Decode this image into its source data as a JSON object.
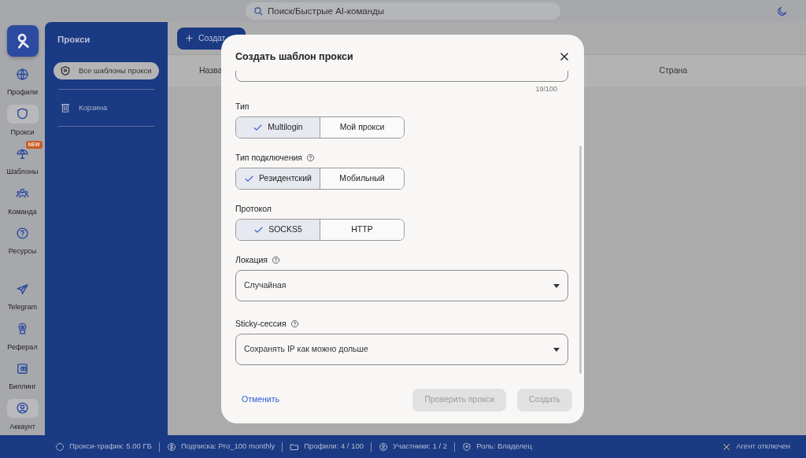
{
  "topbar": {
    "search": {
      "placeholder": "Поиск/Быстрые AI-команды"
    }
  },
  "rail": {
    "items": [
      {
        "label": "Профили",
        "selected": false
      },
      {
        "label": "Прокси",
        "selected": true
      },
      {
        "label": "Шаблоны",
        "selected": false,
        "badge": "NEW"
      },
      {
        "label": "Команда",
        "selected": false
      },
      {
        "label": "Ресурсы",
        "selected": false
      }
    ],
    "bottom_items": [
      {
        "label": "Telegram",
        "selected": false
      },
      {
        "label": "Реферал",
        "selected": false
      },
      {
        "label": "Биллинг",
        "selected": false
      },
      {
        "label": "Аккаунт",
        "selected": true
      }
    ]
  },
  "panel": {
    "title": "Прокси",
    "items": [
      {
        "label": "Все шаблоны прокси",
        "selected": true
      },
      {
        "label": "Корзина",
        "selected": false
      }
    ]
  },
  "toolbar": {
    "create_button": "Создат"
  },
  "table": {
    "columns": [
      "Назва",
      "Страна"
    ]
  },
  "modal": {
    "title": "Создать шаблон прокси",
    "name_counter": "19/100",
    "fields": [
      {
        "kind": "segmented",
        "label": "Тип",
        "help": false,
        "options": [
          {
            "label": "Multilogin",
            "selected": true
          },
          {
            "label": "Мой прокси",
            "selected": false
          }
        ]
      },
      {
        "kind": "segmented",
        "label": "Тип подключения",
        "help": true,
        "options": [
          {
            "label": "Резидентский",
            "selected": true
          },
          {
            "label": "Мобильный",
            "selected": false
          }
        ]
      },
      {
        "kind": "segmented",
        "label": "Протокол",
        "help": false,
        "options": [
          {
            "label": "SOCKS5",
            "selected": true
          },
          {
            "label": "HTTP",
            "selected": false
          }
        ]
      },
      {
        "kind": "select",
        "label": "Локация",
        "help": true,
        "value": "Случайная"
      },
      {
        "kind": "select",
        "label": "Sticky-сессия",
        "help": true,
        "value": "Сохранять IP как можно дольше"
      }
    ],
    "cancel": "Отменить",
    "buttons": [
      {
        "label": "Проверить прокси",
        "disabled": true
      },
      {
        "label": "Создать",
        "disabled": true
      }
    ]
  },
  "status_bar": {
    "items": [
      "Прокси-трафик: 5.00 ГБ",
      "Подписка: Pro_100 monthly",
      "Профили: 4 / 100",
      "Участники: 1 / 2",
      "Роль: Владелец"
    ],
    "agent": "Агент отключен"
  }
}
